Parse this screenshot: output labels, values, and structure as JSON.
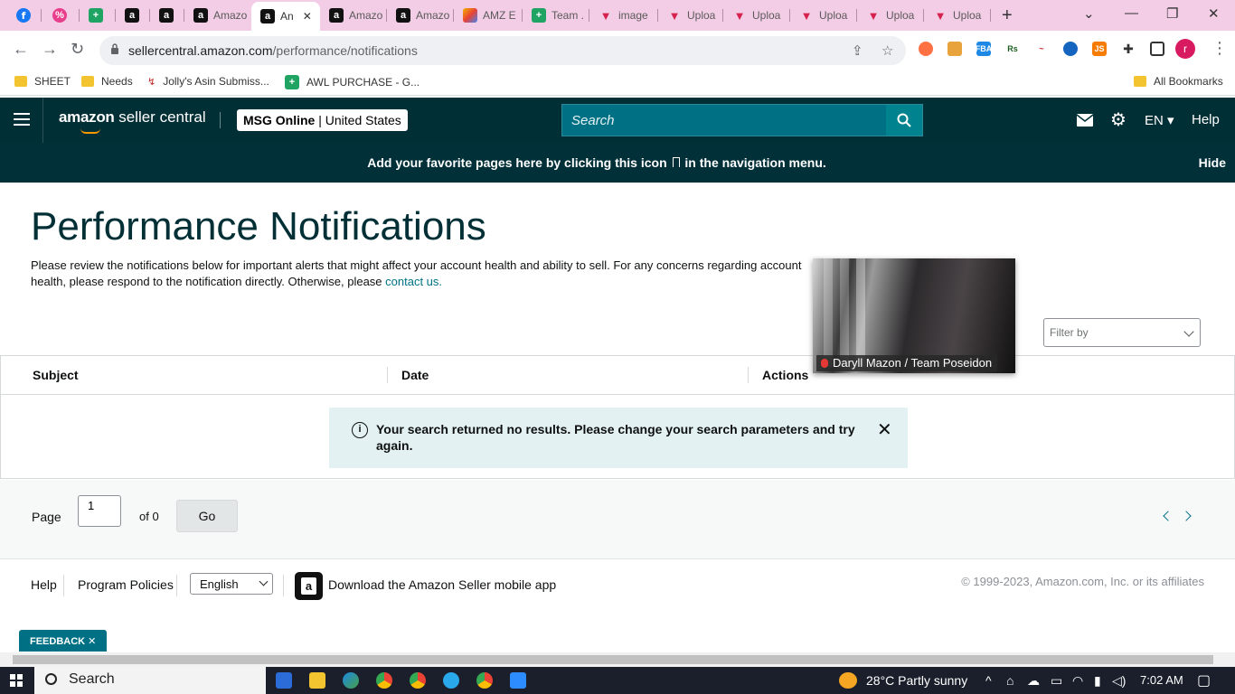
{
  "browser": {
    "tabs": [
      {
        "icon": "facebook-icon",
        "label": ""
      },
      {
        "icon": "percent-icon",
        "label": ""
      },
      {
        "icon": "google-sheets-icon",
        "label": ""
      },
      {
        "icon": "amazon-icon",
        "label": ""
      },
      {
        "icon": "amazon-icon",
        "label": ""
      },
      {
        "icon": "amazon-icon",
        "label": "Amazo"
      },
      {
        "icon": "amazon-icon",
        "label": "An",
        "active": true
      },
      {
        "icon": "amazon-icon",
        "label": "Amazo"
      },
      {
        "icon": "amazon-icon",
        "label": "Amazo"
      },
      {
        "icon": "amz-e-icon",
        "label": "AMZ E"
      },
      {
        "icon": "google-sheets-icon",
        "label": "Team ."
      },
      {
        "icon": "upload-triangle-icon",
        "label": "image"
      },
      {
        "icon": "upload-triangle-icon",
        "label": "Uploa"
      },
      {
        "icon": "upload-triangle-icon",
        "label": "Uploa"
      },
      {
        "icon": "upload-triangle-icon",
        "label": "Uploa"
      },
      {
        "icon": "upload-triangle-icon",
        "label": "Uploa"
      },
      {
        "icon": "upload-triangle-icon",
        "label": "Uploa"
      }
    ],
    "url_host": "sellercentral.amazon.com",
    "url_path": "/performance/notifications",
    "profile_initial": "r",
    "bookmarks": [
      "SHEET",
      "Needs",
      "Jolly's Asin Submiss...",
      "AWL PURCHASE - G..."
    ],
    "all_bookmarks": "All Bookmarks"
  },
  "header": {
    "logo_bold": "amazon",
    "logo_rest": " seller central",
    "store_name": "MSG Online",
    "store_region": " | United States",
    "search_placeholder": "Search",
    "language": "EN",
    "help": "Help",
    "favorites_message": "Add your favorite pages here by clicking this icon",
    "favorites_message_tail": "in the navigation menu.",
    "hide": "Hide"
  },
  "page": {
    "title": "Performance Notifications",
    "description": "Please review the notifications below for important alerts that might affect your account health and ability to sell. For any concerns regarding account health, please respond to the notification directly. Otherwise, please ",
    "contact_link": "contact us.",
    "filter_placeholder": "Filter by",
    "columns": [
      "Subject",
      "Date",
      "Actions"
    ],
    "alert_message": "Your search returned no results. Please change your search parameters and try again.",
    "pager": {
      "label": "Page",
      "current": "1",
      "of": "of 0",
      "go": "Go"
    }
  },
  "footer": {
    "help": "Help",
    "policies": "Program Policies",
    "language": "English",
    "app_text": "Download the Amazon Seller mobile app",
    "copyright": "© 1999-2023, Amazon.com, Inc. or its affiliates",
    "feedback": "FEEDBACK ✕"
  },
  "video_overlay": {
    "participant": "Daryll Mazon / Team Poseidon"
  },
  "taskbar": {
    "search": "Search",
    "weather": "28°C  Partly sunny",
    "time": "7:02 AM"
  },
  "colors": {
    "header_bg": "#002f36",
    "accent": "#007185",
    "alert_bg": "#e3f1f2"
  }
}
